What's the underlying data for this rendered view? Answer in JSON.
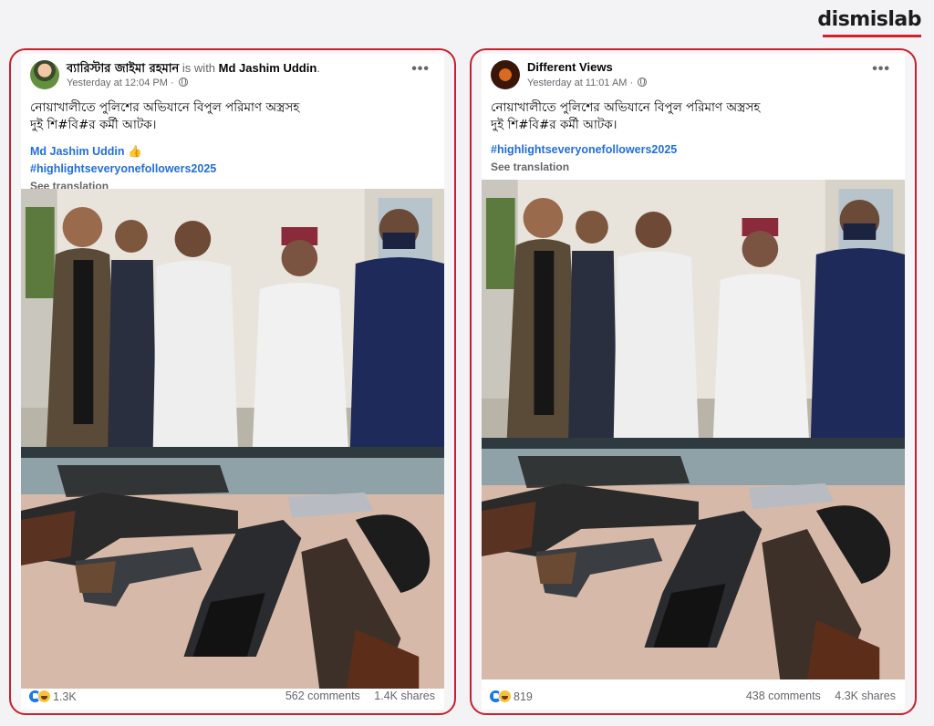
{
  "brand": {
    "name": "dismislab"
  },
  "posts": [
    {
      "author": "ব্যারিস্টার জাইমা রহমান",
      "with_text": "is with",
      "with_name": "Md Jashim Uddin",
      "with_suffix": ".",
      "timestamp": "Yesterday at 12:04 PM",
      "menu": "•••",
      "text_line1": "নোয়াখালীতে পুলিশের অভিযানে বিপুল পরিমাণ অস্ত্রসহ",
      "text_line2": "দুই শি#বি#র কর্মী আটক।",
      "mention": "Md Jashim Uddin 👍",
      "hashtag": "#highlightseveryonefollowers2025",
      "see_translation": "See translation",
      "reaction_count": "1.3K",
      "comments": "562 comments",
      "shares": "1.4K shares"
    },
    {
      "author": "Different Views",
      "timestamp": "Yesterday at 11:01 AM",
      "menu": "•••",
      "text_line1": "নোয়াখালীতে পুলিশের অভিযানে বিপুল পরিমাণ অস্ত্রসহ",
      "text_line2": "দুই শি#বি#র কর্মী আটক।",
      "hashtag": "#highlightseveryonefollowers2025",
      "see_translation": "See translation",
      "reaction_count": "819",
      "comments": "438 comments",
      "shares": "4.3K shares"
    }
  ],
  "colors": {
    "accent_red": "#c8202d",
    "link_blue": "#216fdb",
    "like_blue": "#1877f2",
    "muted_gray": "#65676b"
  },
  "icons": [
    "globe-icon",
    "like-reaction-icon",
    "haha-reaction-icon",
    "more-options-icon"
  ]
}
